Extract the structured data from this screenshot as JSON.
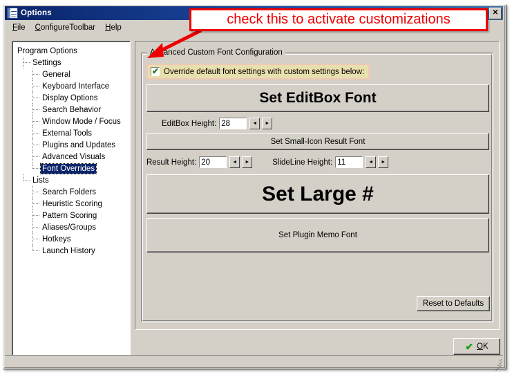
{
  "window": {
    "title": "Options",
    "icon": "options-list-icon",
    "close_label": "✕"
  },
  "menu": {
    "items": [
      {
        "accel": "F",
        "rest": "ile",
        "name": "file"
      },
      {
        "accel": "C",
        "rest": "onfigureToolbar",
        "name": "configure-toolbar"
      },
      {
        "accel": "H",
        "rest": "elp",
        "name": "help"
      }
    ]
  },
  "tree": {
    "nodes": [
      {
        "label": "Program Options",
        "level": 0,
        "selected": false
      },
      {
        "label": "Settings",
        "level": 1,
        "selected": false
      },
      {
        "label": "General",
        "level": 2,
        "selected": false
      },
      {
        "label": "Keyboard Interface",
        "level": 2,
        "selected": false
      },
      {
        "label": "Display Options",
        "level": 2,
        "selected": false
      },
      {
        "label": "Search Behavior",
        "level": 2,
        "selected": false
      },
      {
        "label": "Window Mode / Focus",
        "level": 2,
        "selected": false
      },
      {
        "label": "External Tools",
        "level": 2,
        "selected": false
      },
      {
        "label": "Plugins and Updates",
        "level": 2,
        "selected": false
      },
      {
        "label": "Advanced Visuals",
        "level": 2,
        "selected": false
      },
      {
        "label": "Font Overrides",
        "level": 2,
        "selected": true
      },
      {
        "label": "Lists",
        "level": 1,
        "selected": false
      },
      {
        "label": "Search Folders",
        "level": 2,
        "selected": false
      },
      {
        "label": "Heuristic Scoring",
        "level": 2,
        "selected": false
      },
      {
        "label": "Pattern Scoring",
        "level": 2,
        "selected": false
      },
      {
        "label": "Aliases/Groups",
        "level": 2,
        "selected": false
      },
      {
        "label": "Hotkeys",
        "level": 2,
        "selected": false
      },
      {
        "label": "Launch History",
        "level": 2,
        "selected": false
      }
    ]
  },
  "groupbox": {
    "title": "Advanced Custom Font Configuration"
  },
  "override_checkbox": {
    "label": "Override default font settings with custom settings below:",
    "checked": true,
    "tick": "✔",
    "highlight_color": "#e8dfae",
    "outline_color": "#f0c8b4"
  },
  "buttons": {
    "editbox_font": "Set EditBox Font",
    "small_icon_result_font": "Set Small-Icon Result Font",
    "large_font": "Set Large #",
    "plugin_memo_font": "Set Plugin Memo Font",
    "reset_to_defaults": "Reset to Defaults"
  },
  "fields": {
    "editbox_height": {
      "label": "EditBox Height:",
      "value": "28"
    },
    "result_height": {
      "label": "Result Height:",
      "value": "20"
    },
    "slideline_height": {
      "label": "SlideLine Height:",
      "value": "11"
    }
  },
  "spinner": {
    "dec": "◄",
    "inc": "►"
  },
  "ok_button": {
    "check": "✔",
    "accel": "O",
    "rest": "K"
  },
  "annotation": {
    "text": "check this to activate customizations",
    "color": "#ee0000"
  },
  "statusbar": {
    "text": ""
  }
}
